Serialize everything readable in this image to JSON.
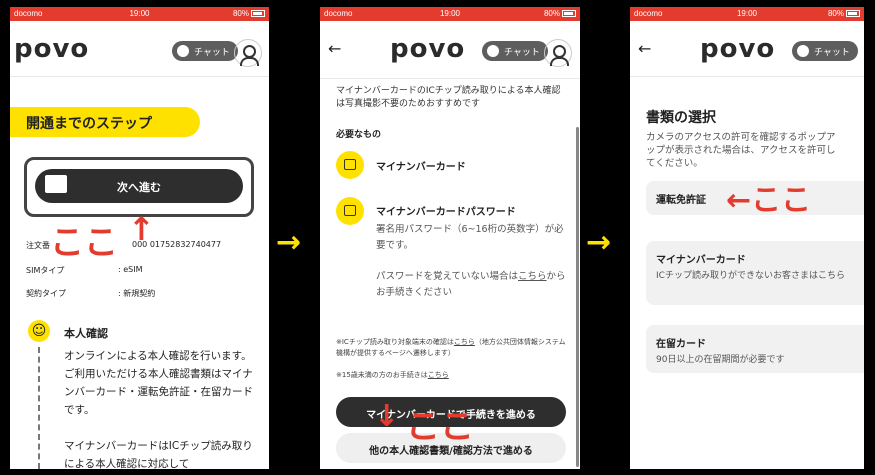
{
  "status_bar": {
    "carrier": "docomo",
    "time": "19:00",
    "battery": "80%"
  },
  "header": {
    "logo": "povo",
    "chat_label": "チャット",
    "back": "←"
  },
  "panel1": {
    "step_title": "開通までのステップ",
    "next_button": "次へ進む",
    "annotation": "ここ",
    "annotation_arrow": "↑",
    "rows": [
      {
        "label": "注文番",
        "value": "000 01752832740477"
      },
      {
        "label": "SIMタイプ",
        "value": ": eSIM"
      },
      {
        "label": "契約タイプ",
        "value": ": 新規契約"
      }
    ],
    "section_title": "本人確認",
    "section_body": "オンラインによる本人確認を行います。ご利用いただける本人確認書類はマイナンバーカード・運転免許証・在留カードです。",
    "section_body2": "マイナンバーカードはICチップ読み取りによる本人確認に対応して"
  },
  "panel2": {
    "top_text": "マイナンバーカードのICチップ読み取りによる本人確認は写真撮影不要のためおすすめです",
    "need_label": "必要なもの",
    "item1": "マイナンバーカード",
    "item2": "マイナンバーカードパスワード",
    "item2_desc": "署名用パスワード（6~16桁の英数字）が必要です。",
    "forgot_pre": "パスワードを覚えていない場合は",
    "forgot_link": "こちら",
    "forgot_post": "からお手続きください",
    "note1_pre": "※ICチップ読み取り対象端末の確認は",
    "note1_link": "こちら",
    "note1_post": "（地方公共団体情報システム機構が提供するページへ遷移します）",
    "note2_pre": "※15歳未満の方のお手続きは",
    "note2_link": "こちら",
    "primary_button": "マイナンバーカードで手続きを進める",
    "secondary_button": "他の本人確認書類/確認方法で進める",
    "annotation": "ここ",
    "annotation_arrow": "↓"
  },
  "panel3": {
    "title": "書類の選択",
    "desc_line1": "カメラのアクセスの許可を確認するポップア",
    "desc_line2": "ップが表示された場合は、アクセスを許可し",
    "desc_line3": "てください。",
    "options": [
      {
        "label": "運転免許証",
        "sub": ""
      },
      {
        "label": "マイナンバーカード",
        "sub": "ICチップ読み取りができないお客さまはこちら"
      },
      {
        "label": "在留カード",
        "sub": "90日以上の在留期間が必要です"
      }
    ],
    "annotation": "←ここ"
  },
  "flow_arrow": "→"
}
